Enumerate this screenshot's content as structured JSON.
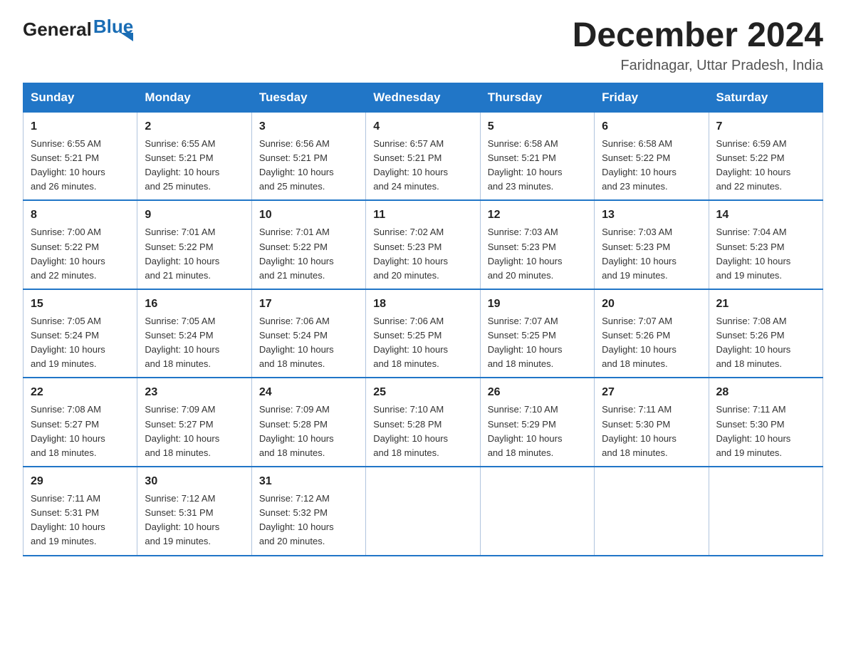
{
  "logo": {
    "general": "General",
    "blue": "Blue"
  },
  "header": {
    "month": "December 2024",
    "location": "Faridnagar, Uttar Pradesh, India"
  },
  "weekdays": [
    "Sunday",
    "Monday",
    "Tuesday",
    "Wednesday",
    "Thursday",
    "Friday",
    "Saturday"
  ],
  "weeks": [
    [
      {
        "day": "1",
        "sunrise": "6:55 AM",
        "sunset": "5:21 PM",
        "daylight": "10 hours and 26 minutes."
      },
      {
        "day": "2",
        "sunrise": "6:55 AM",
        "sunset": "5:21 PM",
        "daylight": "10 hours and 25 minutes."
      },
      {
        "day": "3",
        "sunrise": "6:56 AM",
        "sunset": "5:21 PM",
        "daylight": "10 hours and 25 minutes."
      },
      {
        "day": "4",
        "sunrise": "6:57 AM",
        "sunset": "5:21 PM",
        "daylight": "10 hours and 24 minutes."
      },
      {
        "day": "5",
        "sunrise": "6:58 AM",
        "sunset": "5:21 PM",
        "daylight": "10 hours and 23 minutes."
      },
      {
        "day": "6",
        "sunrise": "6:58 AM",
        "sunset": "5:22 PM",
        "daylight": "10 hours and 23 minutes."
      },
      {
        "day": "7",
        "sunrise": "6:59 AM",
        "sunset": "5:22 PM",
        "daylight": "10 hours and 22 minutes."
      }
    ],
    [
      {
        "day": "8",
        "sunrise": "7:00 AM",
        "sunset": "5:22 PM",
        "daylight": "10 hours and 22 minutes."
      },
      {
        "day": "9",
        "sunrise": "7:01 AM",
        "sunset": "5:22 PM",
        "daylight": "10 hours and 21 minutes."
      },
      {
        "day": "10",
        "sunrise": "7:01 AM",
        "sunset": "5:22 PM",
        "daylight": "10 hours and 21 minutes."
      },
      {
        "day": "11",
        "sunrise": "7:02 AM",
        "sunset": "5:23 PM",
        "daylight": "10 hours and 20 minutes."
      },
      {
        "day": "12",
        "sunrise": "7:03 AM",
        "sunset": "5:23 PM",
        "daylight": "10 hours and 20 minutes."
      },
      {
        "day": "13",
        "sunrise": "7:03 AM",
        "sunset": "5:23 PM",
        "daylight": "10 hours and 19 minutes."
      },
      {
        "day": "14",
        "sunrise": "7:04 AM",
        "sunset": "5:23 PM",
        "daylight": "10 hours and 19 minutes."
      }
    ],
    [
      {
        "day": "15",
        "sunrise": "7:05 AM",
        "sunset": "5:24 PM",
        "daylight": "10 hours and 19 minutes."
      },
      {
        "day": "16",
        "sunrise": "7:05 AM",
        "sunset": "5:24 PM",
        "daylight": "10 hours and 18 minutes."
      },
      {
        "day": "17",
        "sunrise": "7:06 AM",
        "sunset": "5:24 PM",
        "daylight": "10 hours and 18 minutes."
      },
      {
        "day": "18",
        "sunrise": "7:06 AM",
        "sunset": "5:25 PM",
        "daylight": "10 hours and 18 minutes."
      },
      {
        "day": "19",
        "sunrise": "7:07 AM",
        "sunset": "5:25 PM",
        "daylight": "10 hours and 18 minutes."
      },
      {
        "day": "20",
        "sunrise": "7:07 AM",
        "sunset": "5:26 PM",
        "daylight": "10 hours and 18 minutes."
      },
      {
        "day": "21",
        "sunrise": "7:08 AM",
        "sunset": "5:26 PM",
        "daylight": "10 hours and 18 minutes."
      }
    ],
    [
      {
        "day": "22",
        "sunrise": "7:08 AM",
        "sunset": "5:27 PM",
        "daylight": "10 hours and 18 minutes."
      },
      {
        "day": "23",
        "sunrise": "7:09 AM",
        "sunset": "5:27 PM",
        "daylight": "10 hours and 18 minutes."
      },
      {
        "day": "24",
        "sunrise": "7:09 AM",
        "sunset": "5:28 PM",
        "daylight": "10 hours and 18 minutes."
      },
      {
        "day": "25",
        "sunrise": "7:10 AM",
        "sunset": "5:28 PM",
        "daylight": "10 hours and 18 minutes."
      },
      {
        "day": "26",
        "sunrise": "7:10 AM",
        "sunset": "5:29 PM",
        "daylight": "10 hours and 18 minutes."
      },
      {
        "day": "27",
        "sunrise": "7:11 AM",
        "sunset": "5:30 PM",
        "daylight": "10 hours and 18 minutes."
      },
      {
        "day": "28",
        "sunrise": "7:11 AM",
        "sunset": "5:30 PM",
        "daylight": "10 hours and 19 minutes."
      }
    ],
    [
      {
        "day": "29",
        "sunrise": "7:11 AM",
        "sunset": "5:31 PM",
        "daylight": "10 hours and 19 minutes."
      },
      {
        "day": "30",
        "sunrise": "7:12 AM",
        "sunset": "5:31 PM",
        "daylight": "10 hours and 19 minutes."
      },
      {
        "day": "31",
        "sunrise": "7:12 AM",
        "sunset": "5:32 PM",
        "daylight": "10 hours and 20 minutes."
      },
      null,
      null,
      null,
      null
    ]
  ],
  "labels": {
    "sunrise": "Sunrise:",
    "sunset": "Sunset:",
    "daylight": "Daylight:"
  }
}
